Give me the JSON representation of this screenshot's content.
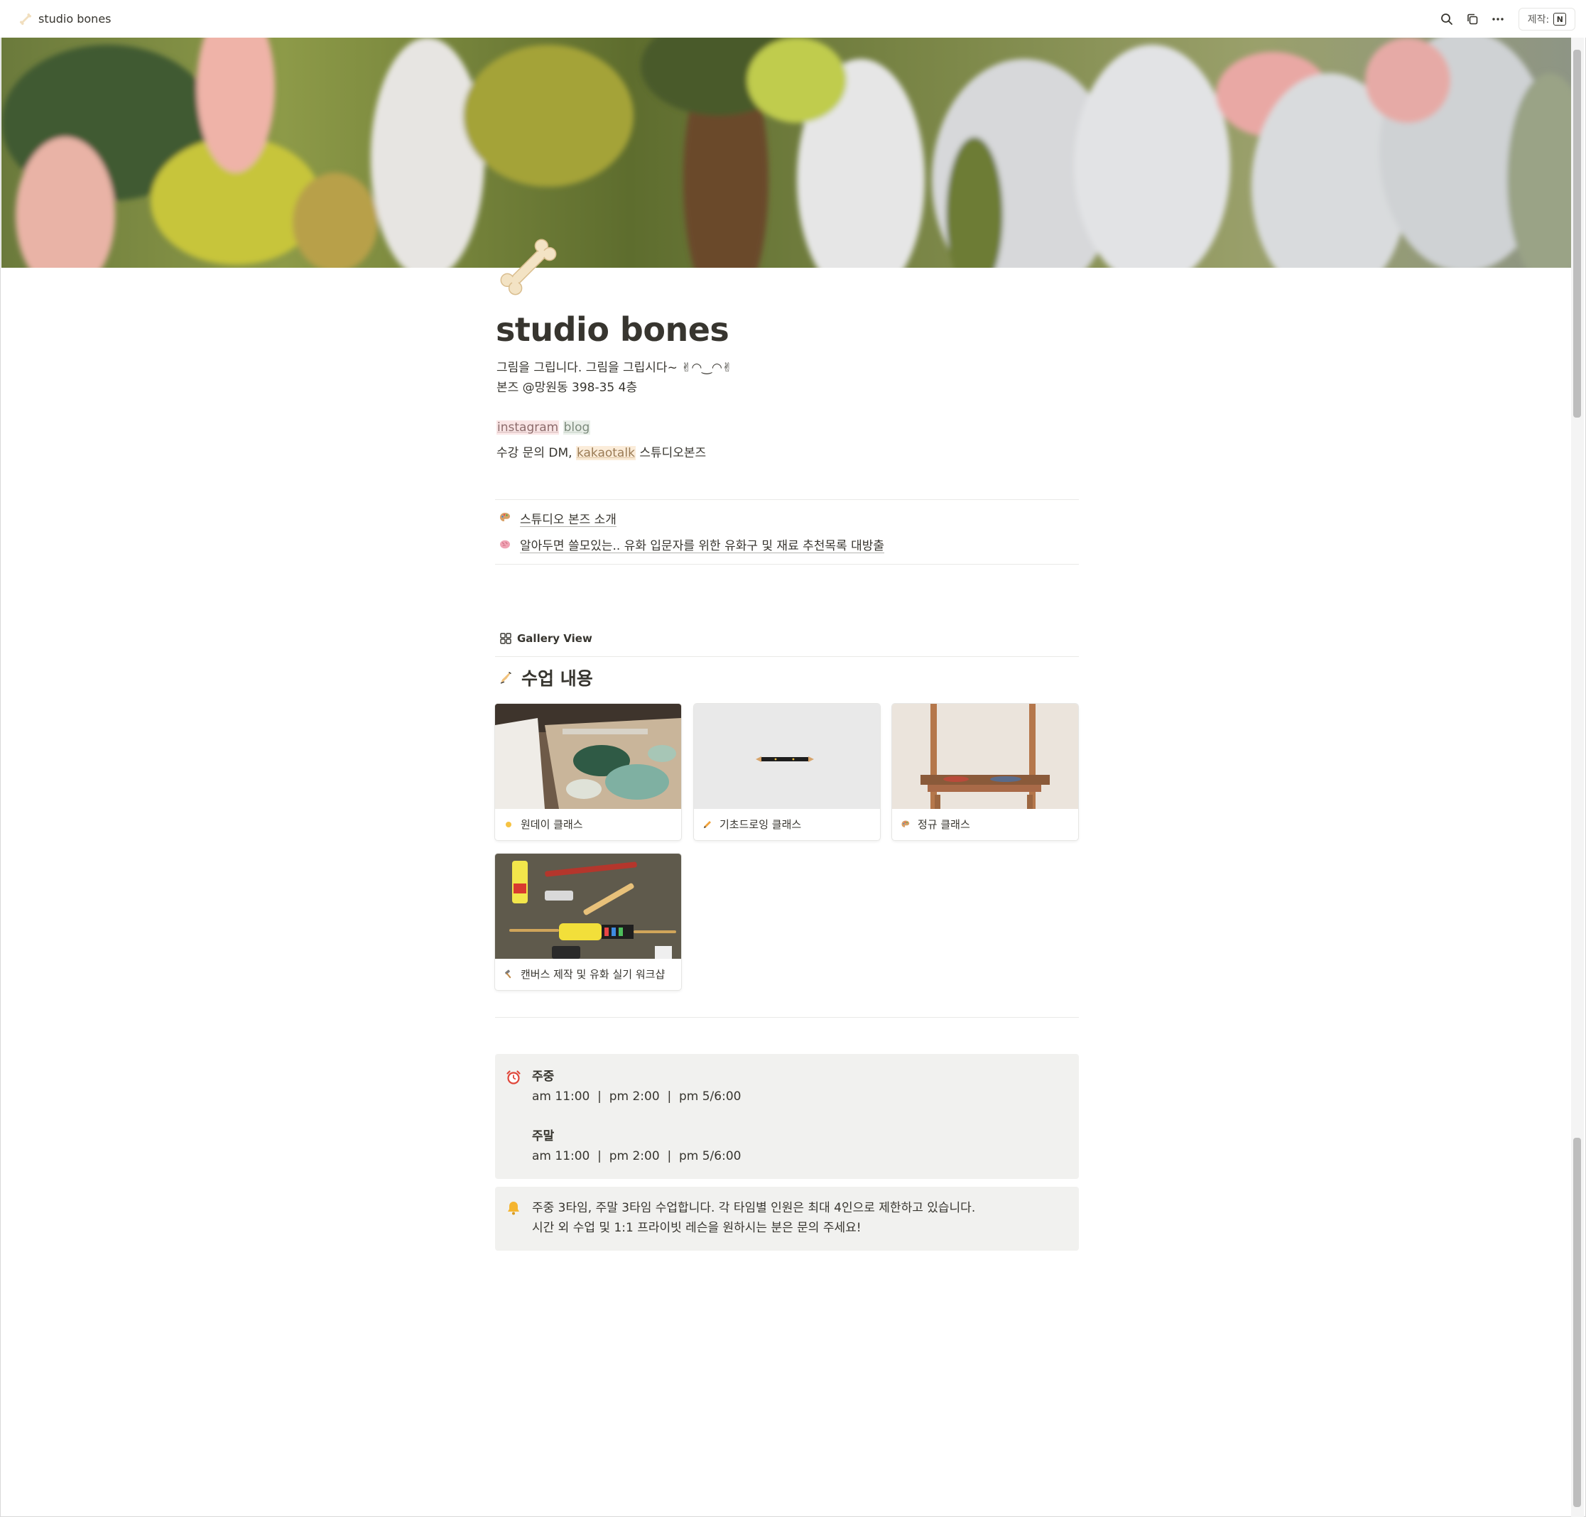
{
  "topbar": {
    "page_title": "studio bones",
    "made_with_label": "제작:",
    "notion_logo": "N"
  },
  "page": {
    "title": "studio bones",
    "tagline": "그림을 그립니다. 그림을 그립시다~ ✌︎◠‿◠✌︎",
    "address": "본즈 @망원동 398-35 4층",
    "links": {
      "instagram": "instagram",
      "blog": "blog"
    },
    "inquiry": {
      "prefix": "수강 문의 DM, ",
      "kakaotalk": "kakaotalk",
      "suffix": " 스튜디오본즈"
    },
    "subpages": [
      {
        "label": "스튜디오 본즈 소개",
        "icon": "palette-icon"
      },
      {
        "label": "알아두면 쓸모있는.. 유화 입문자를 위한 유화구 및 재료 추천목록 대방출",
        "icon": "brain-icon"
      }
    ]
  },
  "gallery": {
    "view_label": "Gallery View",
    "heading": "수업 내용",
    "cards": [
      {
        "label": "원데이 클래스",
        "icon": "sun-icon"
      },
      {
        "label": "기초드로잉 클래스",
        "icon": "pencil-icon"
      },
      {
        "label": "정규 클래스",
        "icon": "palette-icon"
      },
      {
        "label": "캔버스 제작 및 유화 실기 워크샵",
        "icon": "hammer-icon"
      }
    ]
  },
  "schedule": {
    "weekday_label": "주중",
    "weekday_times": "am 11:00  |  pm 2:00  |  pm 5/6:00",
    "weekend_label": "주말",
    "weekend_times": "am 11:00  |  pm 2:00  |  pm 5/6:00"
  },
  "notice": {
    "line1": "주중 3타임, 주말 3타임 수업합니다. 각 타임별 인원은 최대 4인으로 제한하고 있습니다.",
    "line2": "시간 외 수업 및 1:1 프라이빗 레슨을 원하시는 분은 문의 주세요!"
  }
}
